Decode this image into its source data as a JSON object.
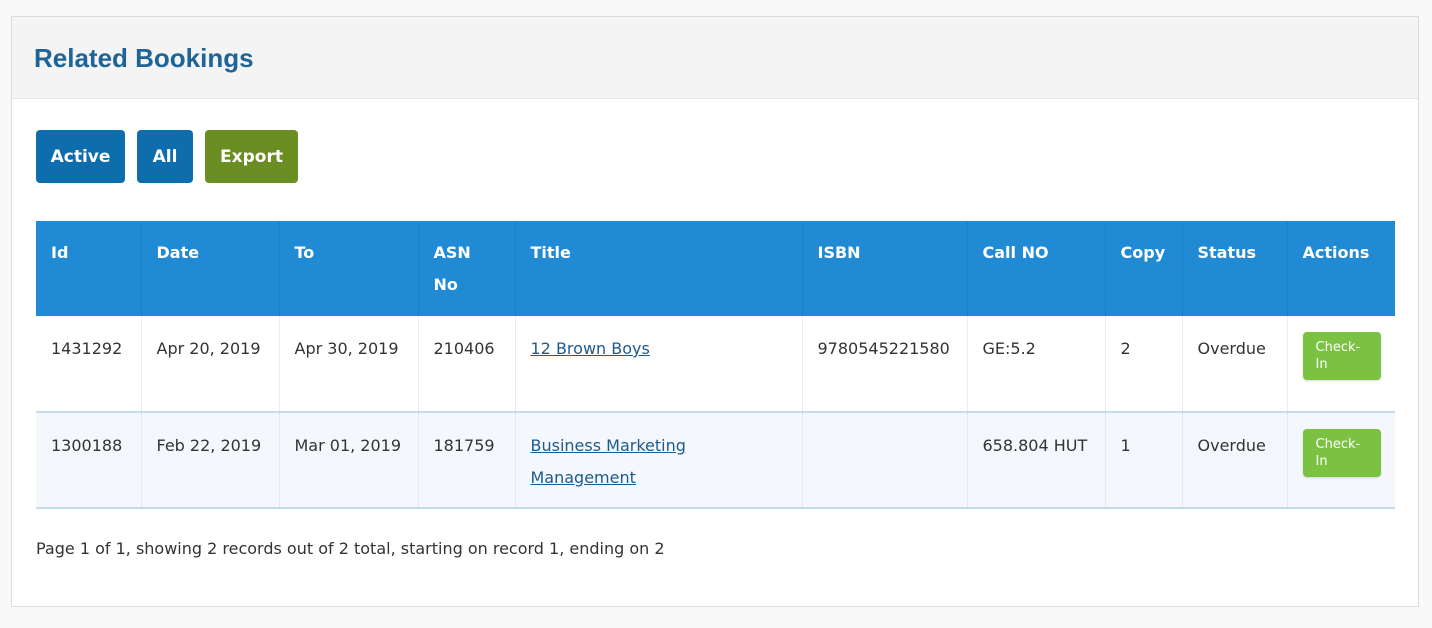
{
  "panel": {
    "title": "Related Bookings"
  },
  "toolbar": {
    "active_label": "Active",
    "all_label": "All",
    "export_label": "Export"
  },
  "table": {
    "columns": [
      "Id",
      "Date",
      "To",
      "ASN No",
      "Title",
      "ISBN",
      "Call NO",
      "Copy",
      "Status",
      "Actions"
    ],
    "rows": [
      {
        "id": "1431292",
        "date": "Apr 20, 2019",
        "to": "Apr 30, 2019",
        "asn": "210406",
        "title": "12 Brown Boys",
        "isbn": "9780545221580",
        "call_no": "GE:5.2",
        "copy": "2",
        "status": "Overdue",
        "action": "Check-In"
      },
      {
        "id": "1300188",
        "date": "Feb 22, 2019",
        "to": "Mar 01, 2019",
        "asn": "181759",
        "title": "Business Marketing Management",
        "isbn": "",
        "call_no": "658.804 HUT",
        "copy": "1",
        "status": "Overdue",
        "action": "Check-In"
      }
    ]
  },
  "pager": {
    "text": "Page 1 of 1, showing 2 records out of 2 total, starting on record 1, ending on 2"
  },
  "colors": {
    "header_bg": "#208bd4",
    "title_text": "#1e6496",
    "primary_button": "#0e6ead",
    "export_button": "#6b8e23",
    "checkin_button": "#7cc242"
  }
}
